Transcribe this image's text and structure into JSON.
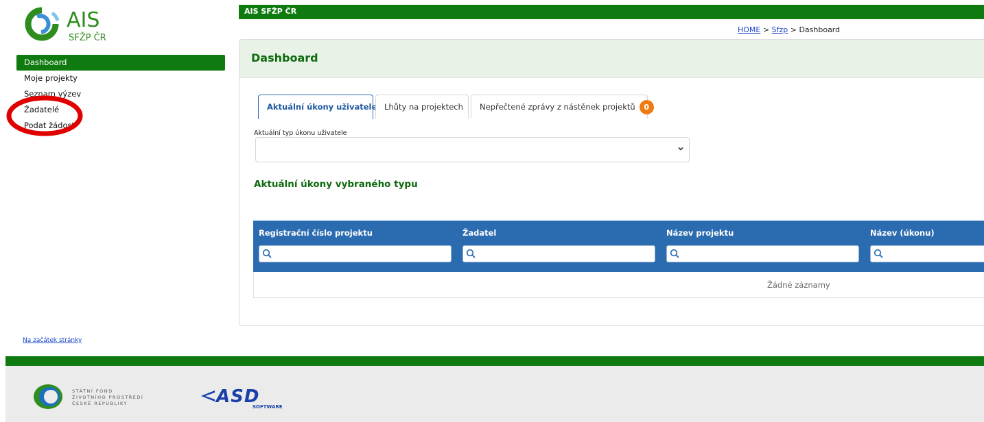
{
  "logo": {
    "title": "AIS",
    "subtitle": "SFŽP ČR"
  },
  "sidebar": {
    "items": [
      {
        "label": "Dashboard",
        "active": true
      },
      {
        "label": "Moje projekty"
      },
      {
        "label": "Seznam výzev"
      },
      {
        "label": "Žadatelé"
      },
      {
        "label": "Podat žádost"
      }
    ]
  },
  "header": {
    "app_name": "AIS SFŽP ČR"
  },
  "breadcrumb": {
    "home": "HOME",
    "sep": ">",
    "section": "Sfzp",
    "current": "Dashboard"
  },
  "main": {
    "title": "Dashboard",
    "tabs": [
      {
        "label": "Aktuální úkony uživatele",
        "active": true
      },
      {
        "label": "Lhůty na projektech"
      },
      {
        "label": "Nepřečtené zprávy z nástěnek projektů",
        "badge": "0"
      }
    ],
    "select": {
      "label": "Aktuální typ úkonu uživatele",
      "value": ""
    },
    "section_title": "Aktuální úkony vybraného typu",
    "table": {
      "columns": [
        "Registrační číslo projektu",
        "Žadatel",
        "Název projektu",
        "Název (úkonu)"
      ],
      "empty_text": "Žádné záznamy"
    }
  },
  "footer": {
    "back_to_top": "Na začátek stránky",
    "sfzp_lines": [
      "STÁTNÍ FOND",
      "ŽIVOTNÍHO PROSTŘEDÍ",
      "ČESKÉ REPUBLIKY"
    ],
    "asd_name": "ASD",
    "asd_sub": "SOFTWARE"
  },
  "colors": {
    "brand_green": "#0f7a0f",
    "table_header_blue": "#2b6cb0",
    "badge_orange": "#f07a12",
    "annotation_red": "#e00000"
  }
}
